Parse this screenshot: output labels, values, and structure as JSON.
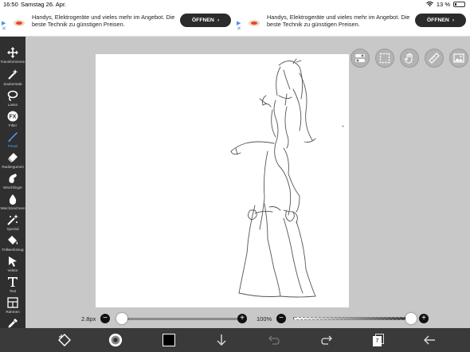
{
  "status": {
    "time": "16:50",
    "date": "Samstag 26. Apr.",
    "battery": "13 %"
  },
  "ads": [
    {
      "text": "Handys, Elektrogeräte und vieles mehr im Angebot. Die beste Technik zu günstigen Preisen.",
      "button": "ÖFFNEN"
    },
    {
      "text": "Handys, Elektrogeräte und vieles mehr im Angebot. Die beste Technik zu günstigen Preisen.",
      "button": "ÖFFNEN"
    }
  ],
  "tools": [
    {
      "name": "transform",
      "label": "Transformieren",
      "icon": "move-arrows-icon"
    },
    {
      "name": "magic-wand",
      "label": "Zauberstab",
      "icon": "magic-wand-icon"
    },
    {
      "name": "lasso",
      "label": "Lasso",
      "icon": "lasso-icon"
    },
    {
      "name": "filter",
      "label": "Filter",
      "icon": "fx-icon"
    },
    {
      "name": "brush",
      "label": "Pinsel",
      "icon": "brush-icon",
      "active": true
    },
    {
      "name": "eraser",
      "label": "Radiergummi",
      "icon": "eraser-icon"
    },
    {
      "name": "smudge",
      "label": "Wischfinger",
      "icon": "smudge-icon"
    },
    {
      "name": "blur",
      "label": "Weichzeichnen",
      "icon": "droplet-icon"
    },
    {
      "name": "special",
      "label": "Spezial",
      "icon": "sparkle-wand-icon"
    },
    {
      "name": "fill",
      "label": "Füllwerkzeug",
      "icon": "fill-bucket-icon"
    },
    {
      "name": "vector",
      "label": "Vektor",
      "icon": "cursor-icon"
    },
    {
      "name": "text",
      "label": "Text",
      "icon": "text-icon"
    },
    {
      "name": "frame",
      "label": "Rahmen",
      "icon": "frame-icon"
    },
    {
      "name": "eyedropper",
      "label": "Pipette",
      "icon": "eyedropper-icon"
    }
  ],
  "brush_size": {
    "label": "2.8px",
    "value_fraction": 0.0
  },
  "opacity": {
    "label": "100%",
    "value_fraction": 1.0
  },
  "layers_count": "7",
  "colors": {
    "sidebar": "#2f2f2f",
    "accent": "#4aa3ff",
    "current_color": "#000000",
    "ad_button": "#2b2b2b"
  }
}
